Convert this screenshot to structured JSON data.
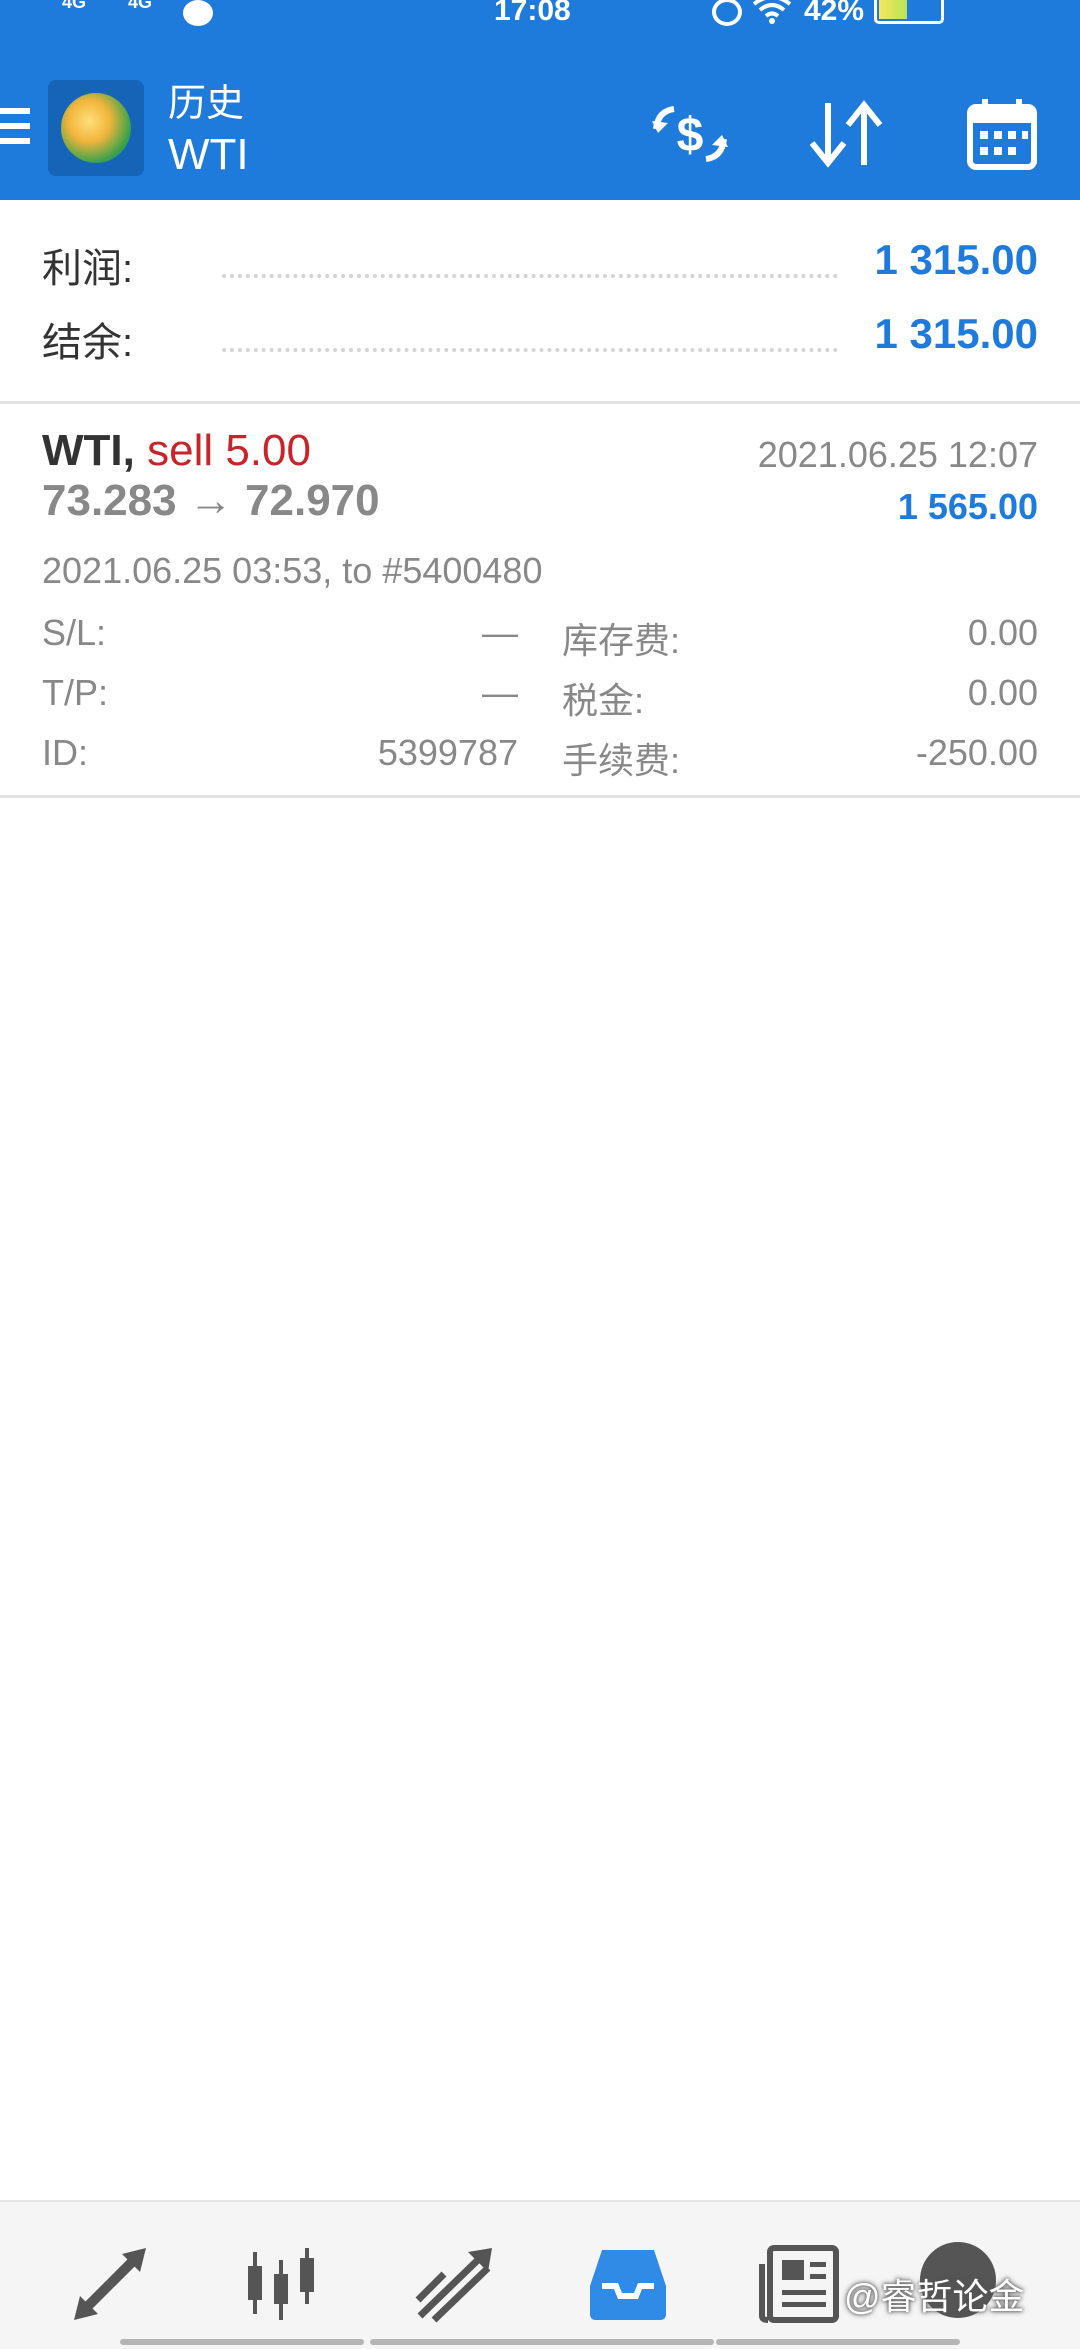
{
  "status_bar": {
    "time": "17:08",
    "battery": "42%",
    "signal_a": "4G",
    "signal_b": "4G"
  },
  "app_bar": {
    "title": "历史",
    "subtitle": "WTI",
    "icons": [
      "menu-icon",
      "metatrader-logo",
      "currency-exchange-icon",
      "sort-icon",
      "calendar-icon"
    ]
  },
  "summary": {
    "profit_label": "利润:",
    "profit_value": "1 315.00",
    "balance_label": "结余:",
    "balance_value": "1 315.00"
  },
  "trade": {
    "symbol": "WTI,",
    "side": "sell 5.00",
    "close_time": "2021.06.25 12:07",
    "prices": "73.283 → 72.970",
    "profit": "1 565.00",
    "open_info": "2021.06.25 03:53, to #5400480",
    "sl_label": "S/L:",
    "sl_value": "—",
    "tp_label": "T/P:",
    "tp_value": "—",
    "id_label": "ID:",
    "id_value": "5399787",
    "swap_label": "库存费:",
    "swap_value": "0.00",
    "tax_label": "税金:",
    "tax_value": "0.00",
    "commission_label": "手续费:",
    "commission_value": "-250.00"
  },
  "bottom_nav": {
    "items": [
      "quotes-icon",
      "chart-icon",
      "trade-icon",
      "history-icon",
      "news-icon",
      "chat-icon"
    ],
    "active": "history-icon",
    "accent": "#2f8be6"
  },
  "watermark": "@睿哲论金",
  "colors": {
    "primary": "#1e7bdb",
    "sell": "#c8242a"
  }
}
